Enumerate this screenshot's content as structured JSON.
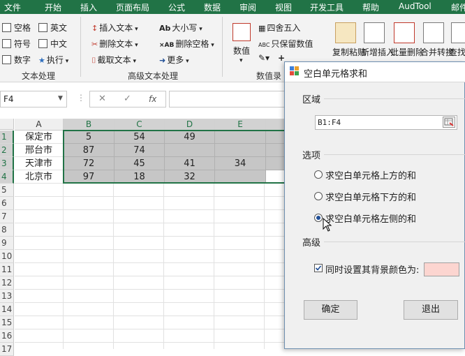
{
  "ribbon_tabs": [
    "文件",
    "开始",
    "插入",
    "页面布局",
    "公式",
    "数据",
    "审阅",
    "视图",
    "开发工具",
    "帮助",
    "AudTool",
    "邮件"
  ],
  "text_group": {
    "checkboxes": [
      "空格",
      "英文",
      "符号",
      "中文",
      "数字"
    ],
    "run_label": "执行",
    "group_label": "文本处理"
  },
  "adv_text_group": {
    "items": [
      "插入文本",
      "删除文本",
      "截取文本",
      "大小写",
      "删除空格",
      "更多"
    ],
    "group_label": "高级文本处理"
  },
  "number_group": {
    "value_label": "数值",
    "items": [
      "四舍五入",
      "只保留数值"
    ],
    "group_label": "数值录"
  },
  "big_buttons": [
    "复制粘贴",
    "新增插入",
    "批量删除",
    "合并转换",
    "查找定位"
  ],
  "name_box": "F4",
  "formula_icons": {
    "cancel": "✕",
    "confirm": "✓",
    "fx": "fx"
  },
  "columns": [
    "A",
    "B",
    "C",
    "D",
    "E"
  ],
  "rows": [
    "1",
    "2",
    "3",
    "4",
    "5",
    "6",
    "7",
    "8",
    "9",
    "10",
    "11",
    "12",
    "13",
    "14",
    "15",
    "16",
    "17"
  ],
  "cells": [
    [
      "保定市",
      "5",
      "54",
      "49",
      ""
    ],
    [
      "邢台市",
      "87",
      "74",
      "",
      ""
    ],
    [
      "天津市",
      "72",
      "45",
      "41",
      "34"
    ],
    [
      "北京市",
      "97",
      "18",
      "32",
      ""
    ]
  ],
  "dialog": {
    "title": "空白单元格求和",
    "region_label": "区域",
    "range_value": "B1:F4",
    "options_label": "选项",
    "options": [
      "求空白单元格上方的和",
      "求空白单元格下方的和",
      "求空白单元格左侧的和"
    ],
    "selected_option": 2,
    "advanced_label": "高级",
    "bg_color_label": "同时设置其背景颜色为:",
    "bg_color": "#fcd5d0",
    "confirm": "确定",
    "exit": "退出"
  },
  "colors": {
    "excel_green": "#217346",
    "selection_gray": "#c6c6c6"
  }
}
